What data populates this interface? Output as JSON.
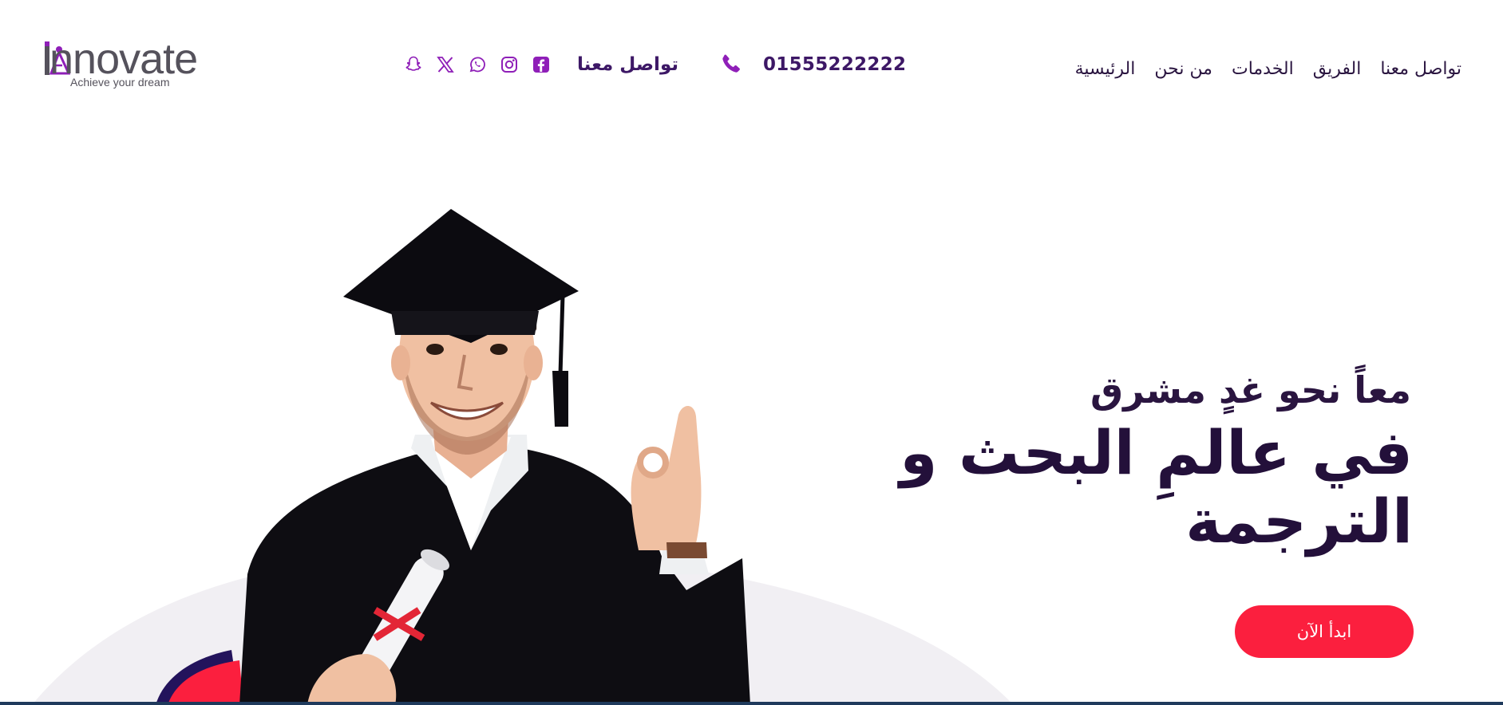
{
  "brand": {
    "name": "nnovate",
    "tagline": "Achieve your dream"
  },
  "header": {
    "socials": [
      {
        "icon": "snapchat-icon"
      },
      {
        "icon": "x-icon"
      },
      {
        "icon": "whatsapp-icon"
      },
      {
        "icon": "instagram-icon"
      },
      {
        "icon": "facebook-icon"
      }
    ],
    "contact_label": "تواصل معنا",
    "phone_icon": "phone-icon",
    "phone_number": "01555222222",
    "nav": [
      {
        "label": "الرئيسية"
      },
      {
        "label": "من نحن"
      },
      {
        "label": "الخدمات"
      },
      {
        "label": "الفريق"
      },
      {
        "label": "تواصل معنا"
      }
    ]
  },
  "hero": {
    "subtitle": "معاً نحو غدٍ مشرق",
    "title": "في عالمِ البحث و الترجمة",
    "cta_label": "ابدأ الآن"
  },
  "colors": {
    "accent_purple": "#8f1fb8",
    "text_dark": "#23103a",
    "cta_red": "#fb1f3e",
    "bg_arc": "#f1eff3"
  }
}
